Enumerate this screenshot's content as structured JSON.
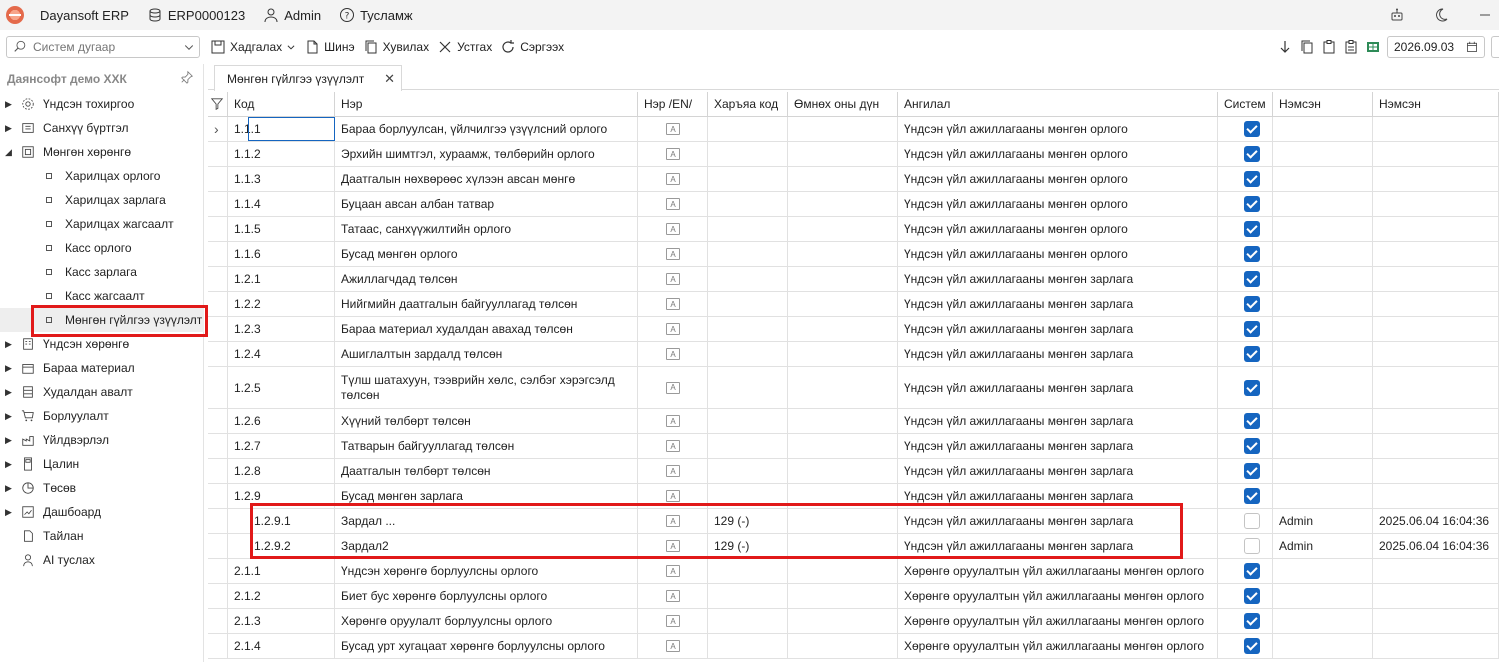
{
  "titlebar": {
    "app_name": "Dayansoft ERP",
    "db_name": "ERP0000123",
    "user": "Admin",
    "help": "Тусламж"
  },
  "toolbar": {
    "search_placeholder": "Систем дугаар",
    "save": "Хадгалах",
    "new": "Шинэ",
    "copy": "Хувилах",
    "delete": "Устгах",
    "refresh": "Сэргээх",
    "date": "2026.09.03"
  },
  "sidebar": {
    "company": "Даянсофт демо ХХК",
    "items": [
      {
        "label": "Үндсэн тохиргоо",
        "icon": "gear-icon",
        "expanded": false
      },
      {
        "label": "Санхүү бүртгэл",
        "icon": "ledger-icon",
        "expanded": false
      },
      {
        "label": "Мөнгөн хөрөнгө",
        "icon": "cash-icon",
        "expanded": true
      },
      {
        "label": "Үндсэн хөрөнгө",
        "icon": "building-icon",
        "expanded": false
      },
      {
        "label": "Бараа материал",
        "icon": "box-icon",
        "expanded": false
      },
      {
        "label": "Худалдан авалт",
        "icon": "purchase-icon",
        "expanded": false
      },
      {
        "label": "Борлуулалт",
        "icon": "cart-icon",
        "expanded": false
      },
      {
        "label": "Үйлдвэрлэл",
        "icon": "factory-icon",
        "expanded": false
      },
      {
        "label": "Цалин",
        "icon": "calculator-icon",
        "expanded": false
      },
      {
        "label": "Төсөв",
        "icon": "pie-chart-icon",
        "expanded": false
      },
      {
        "label": "Дашбоард",
        "icon": "dashboard-icon",
        "expanded": false
      },
      {
        "label": "Тайлан",
        "icon": "report-icon",
        "expanded": false
      },
      {
        "label": "AI туслах",
        "icon": "assistant-icon",
        "expanded": false
      }
    ],
    "subitems": [
      "Харилцах орлого",
      "Харилцах зарлага",
      "Харилцах жагсаалт",
      "Касс орлого",
      "Касс зарлага",
      "Касс жагсаалт",
      "Мөнгөн гүйлгээ үзүүлэлт"
    ]
  },
  "tab": {
    "label": "Мөнгөн гүйлгээ үзүүлэлт"
  },
  "grid": {
    "columns": [
      "Код",
      "Нэр",
      "Нэр /EN/",
      "Харъяа код",
      "Өмнөх оны дүн",
      "Ангилал",
      "Систем",
      "Нэмсэн",
      "Нэмсэн"
    ],
    "rows": [
      {
        "code": "1.1.1",
        "name": "Бараа борлуулсан, үйлчилгээ үзүүлсний орлого",
        "parent": "",
        "prev": "",
        "category": "Үндсэн үйл ажиллагааны мөнгөн орлого",
        "system": true,
        "added_by": "",
        "added_at": ""
      },
      {
        "code": "1.1.2",
        "name": "Эрхийн шимтгэл, хураамж, төлбөрийн орлого",
        "parent": "",
        "prev": "",
        "category": "Үндсэн үйл ажиллагааны мөнгөн орлого",
        "system": true,
        "added_by": "",
        "added_at": ""
      },
      {
        "code": "1.1.3",
        "name": "Даатгалын нөхвөрөөс хүлээн авсан мөнгө",
        "parent": "",
        "prev": "",
        "category": "Үндсэн үйл ажиллагааны мөнгөн орлого",
        "system": true,
        "added_by": "",
        "added_at": ""
      },
      {
        "code": "1.1.4",
        "name": "Буцаан авсан албан татвар",
        "parent": "",
        "prev": "",
        "category": "Үндсэн үйл ажиллагааны мөнгөн орлого",
        "system": true,
        "added_by": "",
        "added_at": ""
      },
      {
        "code": "1.1.5",
        "name": "Татаас, санхүүжилтийн орлого",
        "parent": "",
        "prev": "",
        "category": "Үндсэн үйл ажиллагааны мөнгөн орлого",
        "system": true,
        "added_by": "",
        "added_at": ""
      },
      {
        "code": "1.1.6",
        "name": "Бусад мөнгөн орлого",
        "parent": "",
        "prev": "",
        "category": "Үндсэн үйл ажиллагааны мөнгөн орлого",
        "system": true,
        "added_by": "",
        "added_at": ""
      },
      {
        "code": "1.2.1",
        "name": "Ажиллагчдад төлсөн",
        "parent": "",
        "prev": "",
        "category": "Үндсэн үйл ажиллагааны мөнгөн зарлага",
        "system": true,
        "added_by": "",
        "added_at": ""
      },
      {
        "code": "1.2.2",
        "name": "Нийгмийн даатгалын байгууллагад төлсөн",
        "parent": "",
        "prev": "",
        "category": "Үндсэн үйл ажиллагааны мөнгөн зарлага",
        "system": true,
        "added_by": "",
        "added_at": ""
      },
      {
        "code": "1.2.3",
        "name": "Бараа материал худалдан авахад төлсөн",
        "parent": "",
        "prev": "",
        "category": "Үндсэн үйл ажиллагааны мөнгөн зарлага",
        "system": true,
        "added_by": "",
        "added_at": ""
      },
      {
        "code": "1.2.4",
        "name": "Ашиглалтын зардалд төлсөн",
        "parent": "",
        "prev": "",
        "category": "Үндсэн үйл ажиллагааны мөнгөн зарлага",
        "system": true,
        "added_by": "",
        "added_at": ""
      },
      {
        "code": "1.2.5",
        "name": "Түлш шатахуун, тээврийн хөлс, сэлбэг хэрэгсэлд төлсөн",
        "parent": "",
        "prev": "",
        "category": "Үндсэн үйл ажиллагааны мөнгөн зарлага",
        "system": true,
        "added_by": "",
        "added_at": ""
      },
      {
        "code": "1.2.6",
        "name": "Хүүний төлбөрт төлсөн",
        "parent": "",
        "prev": "",
        "category": "Үндсэн үйл ажиллагааны мөнгөн зарлага",
        "system": true,
        "added_by": "",
        "added_at": ""
      },
      {
        "code": "1.2.7",
        "name": "Татварын байгууллагад төлсөн",
        "parent": "",
        "prev": "",
        "category": "Үндсэн үйл ажиллагааны мөнгөн зарлага",
        "system": true,
        "added_by": "",
        "added_at": ""
      },
      {
        "code": "1.2.8",
        "name": "Даатгалын төлбөрт төлсөн",
        "parent": "",
        "prev": "",
        "category": "Үндсэн үйл ажиллагааны мөнгөн зарлага",
        "system": true,
        "added_by": "",
        "added_at": ""
      },
      {
        "code": "1.2.9",
        "name": "Бусад мөнгөн зарлага",
        "parent": "",
        "prev": "",
        "category": "Үндсэн үйл ажиллагааны мөнгөн зарлага",
        "system": true,
        "added_by": "",
        "added_at": ""
      },
      {
        "code": "1.2.9.1",
        "name": "Зардал ...",
        "parent": "129 (-)",
        "prev": "",
        "category": "Үндсэн үйл ажиллагааны мөнгөн зарлага",
        "system": false,
        "added_by": "Admin",
        "added_at": "2025.06.04 16:04:36"
      },
      {
        "code": "1.2.9.2",
        "name": "Зардал2",
        "parent": "129 (-)",
        "prev": "",
        "category": "Үндсэн үйл ажиллагааны мөнгөн зарлага",
        "system": false,
        "added_by": "Admin",
        "added_at": "2025.06.04 16:04:36"
      },
      {
        "code": "2.1.1",
        "name": "Үндсэн хөрөнгө борлуулсны орлого",
        "parent": "",
        "prev": "",
        "category": "Хөрөнгө оруулалтын үйл ажиллагааны мөнгөн орлого",
        "system": true,
        "added_by": "",
        "added_at": ""
      },
      {
        "code": "2.1.2",
        "name": "Биет бус хөрөнгө борлуулсны орлого",
        "parent": "",
        "prev": "",
        "category": "Хөрөнгө оруулалтын үйл ажиллагааны мөнгөн орлого",
        "system": true,
        "added_by": "",
        "added_at": ""
      },
      {
        "code": "2.1.3",
        "name": "Хөрөнгө оруулалт борлуулсны орлого",
        "parent": "",
        "prev": "",
        "category": "Хөрөнгө оруулалтын үйл ажиллагааны мөнгөн орлого",
        "system": true,
        "added_by": "",
        "added_at": ""
      },
      {
        "code": "2.1.4",
        "name": "Бусад урт хугацаат хөрөнгө борлуулсны орлого",
        "parent": "",
        "prev": "",
        "category": "Хөрөнгө оруулалтын үйл ажиллагааны мөнгөн орлого",
        "system": true,
        "added_by": "",
        "added_at": ""
      }
    ]
  },
  "colors": {
    "accent": "#1565c0",
    "highlight": "#e11919"
  }
}
